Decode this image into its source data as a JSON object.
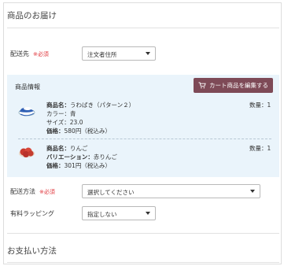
{
  "delivery": {
    "section_title": "商品のお届け",
    "address_label": "配送先",
    "required": "※必須",
    "address_value": "注文者住所"
  },
  "product_panel": {
    "title": "商品情報",
    "edit_button": "カート商品を編集する",
    "items": [
      {
        "name_label": "商品名：",
        "name": "うわばき（パターン２）",
        "line2": "カラー：青",
        "line3": "サイズ：23.0",
        "price_label": "価格：",
        "price": "580円（税込み）",
        "qty": "数量：1",
        "icon": "shoe-icon"
      },
      {
        "name_label": "商品名：",
        "name": "りんご",
        "line2_label": "バリエーション：",
        "line2_value": "赤りんご",
        "price_label": "価格：",
        "price": "301円（税込み）",
        "qty": "数量：1",
        "icon": "apple-icon"
      }
    ]
  },
  "shipping": {
    "label": "配送方法",
    "required": "※必須",
    "value": "選択してください"
  },
  "wrapping": {
    "label": "有料ラッピング",
    "value": "指定しない"
  },
  "payment": {
    "section_title": "お支払い方法"
  },
  "colors": {
    "edit_button": "#7e4a57",
    "panel_bg": "#eaf4fb",
    "required": "#e0353b"
  }
}
